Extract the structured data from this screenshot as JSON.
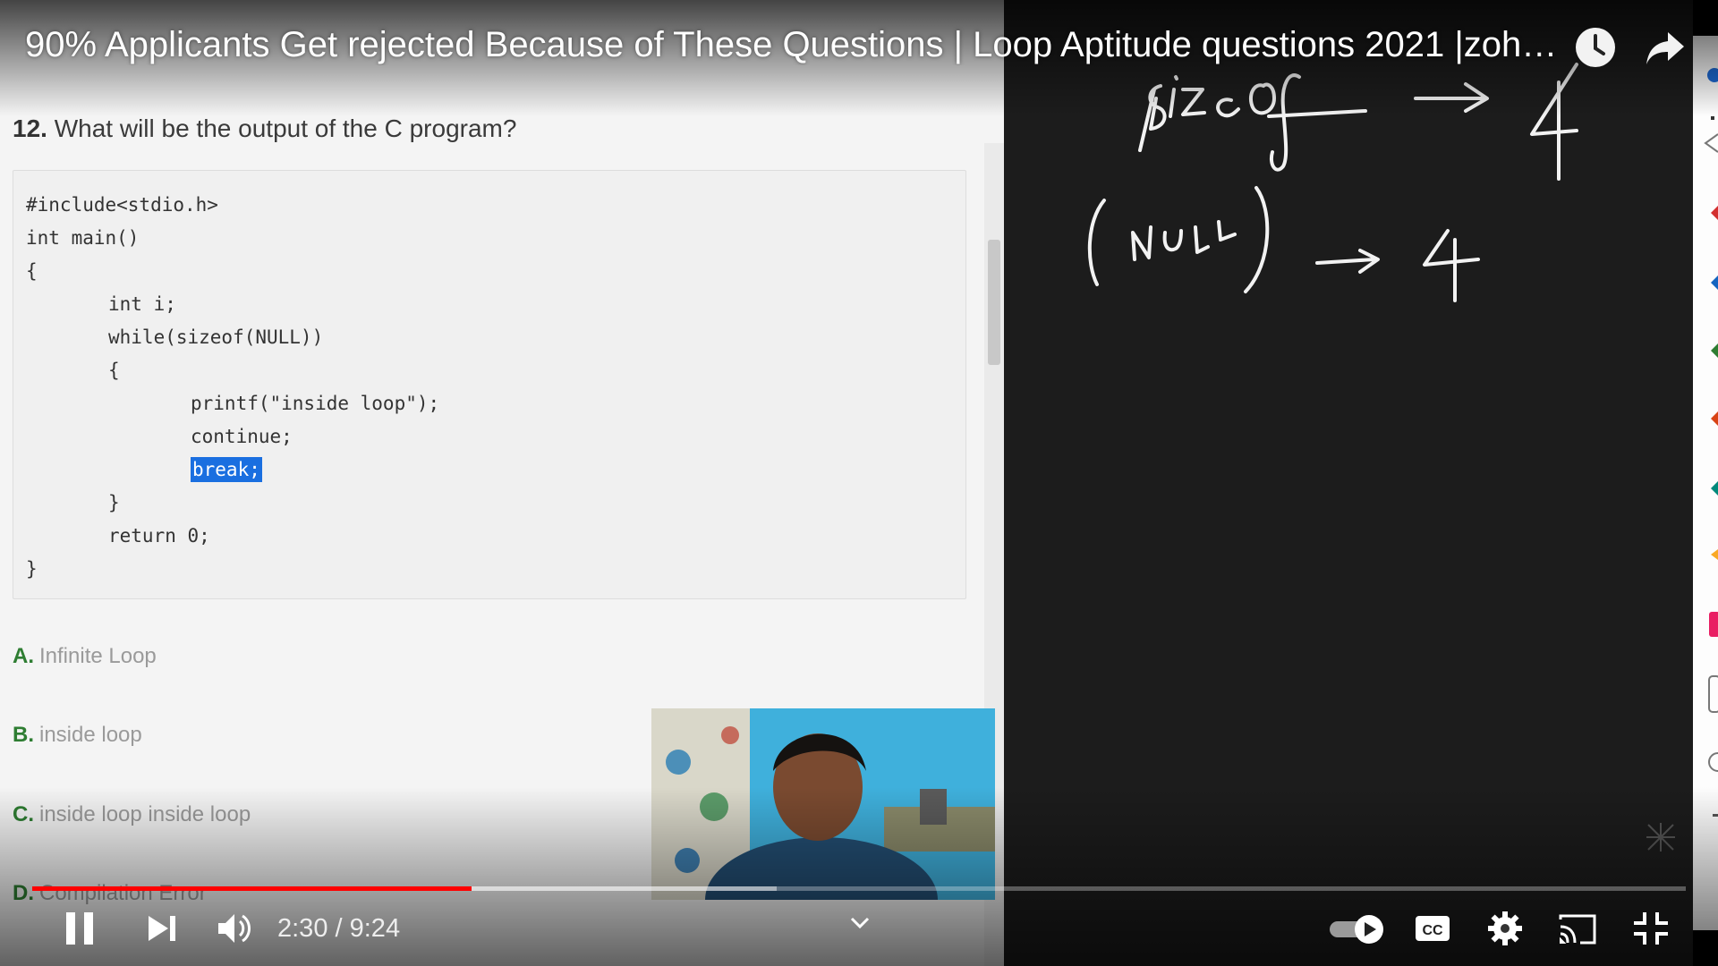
{
  "player": {
    "video_title": "90% Applicants Get rejected Because of These Questions | Loop Aptitude questions 2021 |zoh…",
    "time_current": "2:30",
    "time_separator": " / ",
    "time_total": "9:24",
    "progress_played": 0.2655,
    "progress_buffered": 0.45,
    "icons": {
      "watch_later": "clock-icon",
      "share": "share-icon",
      "pause": "pause-icon",
      "next": "next-icon",
      "volume": "volume-icon",
      "chapters": "chevron-down-icon",
      "autoplay": "autoplay-toggle-icon",
      "captions": "cc-icon",
      "settings": "gear-icon",
      "cast": "cast-icon",
      "exit_fullscreen": "exit-fullscreen-icon"
    },
    "accent_color": "#ff0000"
  },
  "quiz": {
    "question_number": "12.",
    "question_text": "What will be the output of the C program?",
    "code": {
      "l1": "#include<stdio.h>",
      "l2": "int main()",
      "l3": "{",
      "l4": "int i;",
      "l5": "while(sizeof(NULL))",
      "l6": "{",
      "l7": "printf(\"inside loop\");",
      "l8": "continue;",
      "l9": "break;",
      "l10": "}",
      "l11": "return 0;",
      "l12": "}"
    },
    "options": [
      {
        "letter": "A.",
        "text": "Infinite Loop"
      },
      {
        "letter": "B.",
        "text": "inside loop"
      },
      {
        "letter": "C.",
        "text": "inside loop inside loop"
      },
      {
        "letter": "D.",
        "text": "Compilation Error"
      }
    ]
  },
  "board": {
    "background": "#1c1c1c"
  }
}
